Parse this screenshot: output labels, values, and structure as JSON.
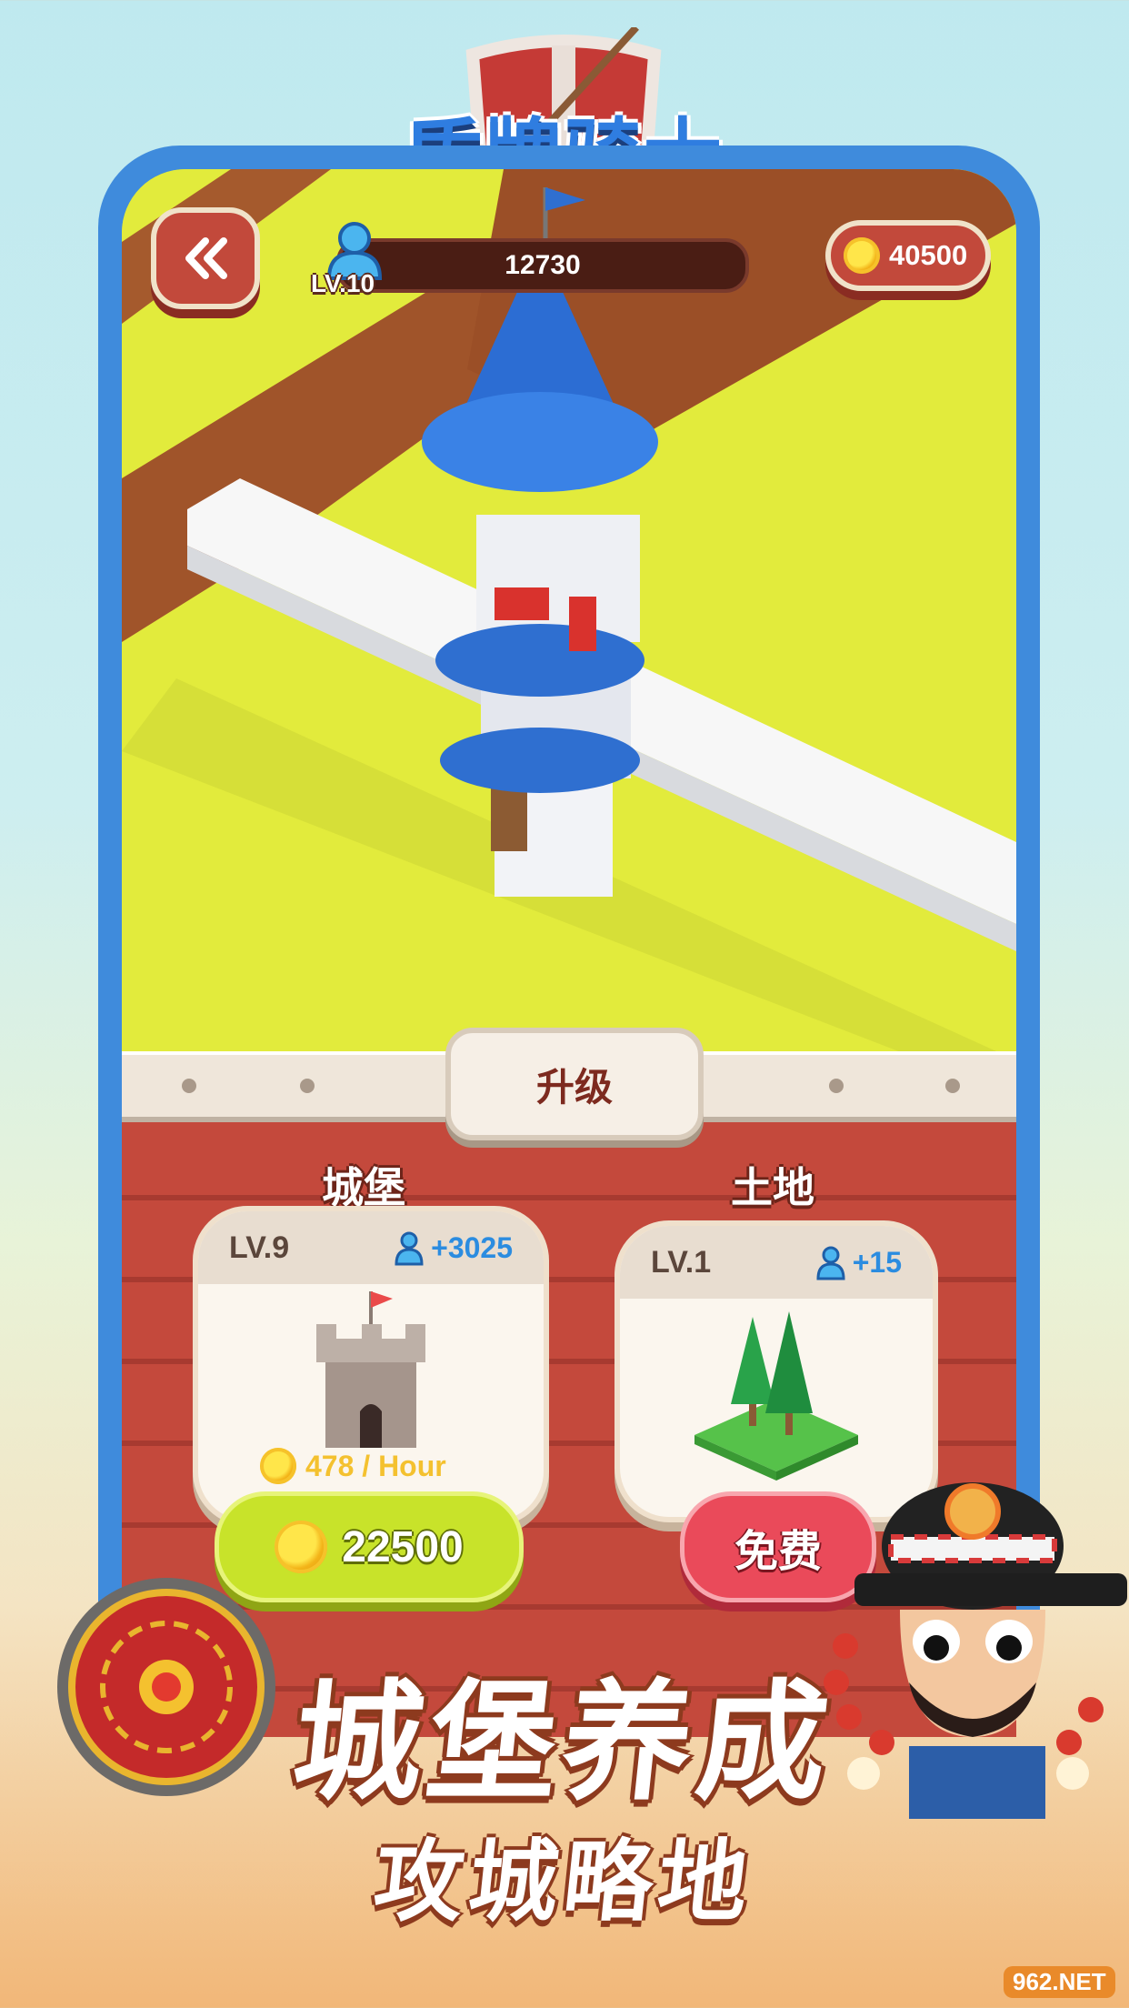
{
  "logo": {
    "title": "盾牌骑士"
  },
  "hud": {
    "back_icon": "double-chevron-left-icon",
    "level": "LV.10",
    "xp": "12730",
    "coins": "40500"
  },
  "panel": {
    "tab_label": "升级",
    "castle": {
      "title": "城堡",
      "level": "LV.9",
      "population": "+3025",
      "rate": "478 / Hour",
      "price": "22500"
    },
    "land": {
      "title": "土地",
      "level": "LV.1",
      "population": "+15",
      "button": "免费"
    }
  },
  "promo": {
    "headline": "城堡养成",
    "subline": "攻城略地"
  },
  "watermark": "962.NET",
  "colors": {
    "phone_frame": "#3f8bdc",
    "grass": "#e3ec3d",
    "wood_panel": "#c4493c",
    "buy_button": "#c8e32a",
    "free_button": "#ea4a5a"
  }
}
